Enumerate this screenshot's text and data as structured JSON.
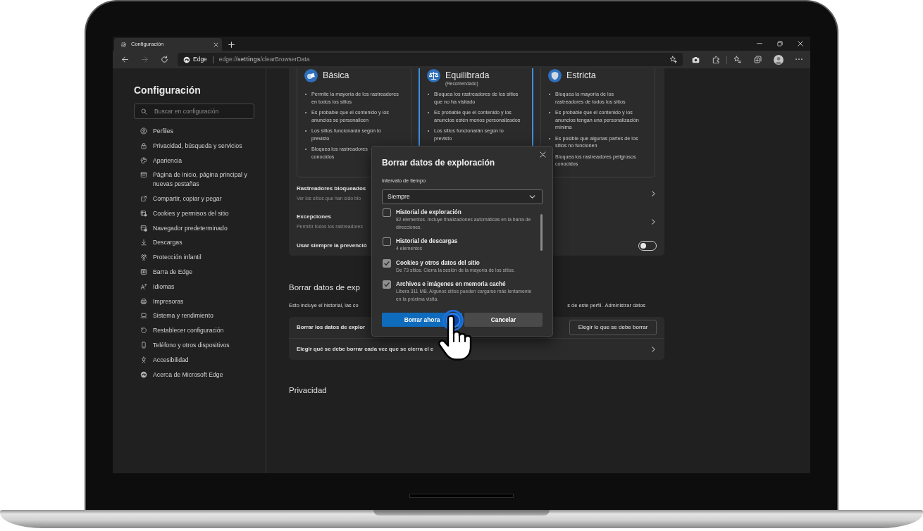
{
  "browser": {
    "tab": {
      "title": "Configuración"
    },
    "nav_buttons": [
      {
        "kind": "back",
        "disabled": false
      },
      {
        "kind": "forward",
        "disabled": true
      },
      {
        "kind": "refresh",
        "disabled": false
      }
    ],
    "address": {
      "label": "Edge",
      "url": "edge://**settings**/clearBrowserData"
    }
  },
  "sidebar": {
    "title": "Configuración",
    "search": {
      "placeholder": "Buscar en configuración"
    },
    "items": [
      {
        "label": "Perfiles",
        "selected": false
      },
      {
        "label": "Privacidad, búsqueda y servicios",
        "selected": false
      },
      {
        "label": "Apariencia",
        "selected": false
      },
      {
        "label": "Página de inicio, página principal y nuevas pestañas",
        "selected": false
      },
      {
        "label": "Compartir, copiar y pegar",
        "selected": false
      },
      {
        "label": "Cookies y permisos del sitio",
        "selected": false
      },
      {
        "label": "Navegador predeterminado",
        "selected": false
      },
      {
        "label": "Descargas",
        "selected": false
      },
      {
        "label": "Protección infantil",
        "selected": false
      },
      {
        "label": "Barra de Edge",
        "selected": false
      },
      {
        "label": "Idiomas",
        "selected": false
      },
      {
        "label": "Impresoras",
        "selected": false
      },
      {
        "label": "Sistema y rendimiento",
        "selected": false
      },
      {
        "label": "Restablecer configuración",
        "selected": false
      },
      {
        "label": "Teléfono y otros dispositivos",
        "selected": false
      },
      {
        "label": "Accesibilidad",
        "selected": false
      },
      {
        "label": "Acerca de Microsoft Edge",
        "selected": false
      }
    ]
  },
  "tracking_prevention": {
    "options": [
      {
        "title": "Básica",
        "selected": false,
        "bullets": [
          [
            "Permite la mayoría de los rastreadores",
            "en todos los sitios"
          ],
          [
            "Es probable que el contenido y los",
            "anuncios se personalicen"
          ],
          [
            "Los sitios funcionarán según lo",
            "previsto"
          ],
          [
            "Bloquea los rastreadores",
            "conocidos"
          ]
        ]
      },
      {
        "title": "Equilibrada",
        "subtitle": "(Recomendado)",
        "selected": true,
        "bullets": [
          [
            "Bloquea los rastreadores de los sitios",
            "que no ha visitado"
          ],
          [
            "Es probable que el contenido y los",
            "anuncios estén menos personalizados"
          ],
          [
            "Los sitios funcionarán según lo",
            "previsto"
          ]
        ]
      },
      {
        "title": "Estricta",
        "selected": false,
        "bullets": [
          [
            "Bloquea la mayoría de los",
            "rastreadores de todos los sitios"
          ],
          [
            "Es probable que el contenido y los",
            "anuncios tengan una personalización",
            "mínima"
          ],
          [
            "Es posible que algunas partes de los",
            "sitios no funcionen"
          ],
          [
            "Bloquea los rastreadores peligrosos",
            "conocidos"
          ]
        ]
      }
    ],
    "rows": [
      {
        "kind": "link",
        "title": "Rastreadores bloqueados",
        "description": "Ver los sitios que han sido blo"
      },
      {
        "kind": "link",
        "title": "Excepciones",
        "description": "Permitir todos los rastreadores"
      },
      {
        "kind": "toggle",
        "title": "Usar siempre la prevenció",
        "on": false
      }
    ]
  },
  "clear_data": {
    "heading": "Borrar datos de exp",
    "description_start": "Esto incluye el historial, las co",
    "description_end": "s de este perfil.",
    "link": "Administrar datos",
    "rows": [
      {
        "kind": "button",
        "title": "Borrar los datos de explor",
        "button": "Elegir lo que se debe borrar"
      },
      {
        "kind": "link",
        "title": "Elegir qué se debe borrar cada vez que se cierra el e"
      }
    ]
  },
  "privacy": {
    "heading": "Privacidad"
  },
  "dialog": {
    "title": "Borrar datos de exploración",
    "range_label": "Intervalo de tiempo",
    "range_value": "Siempre",
    "items": [
      {
        "title": "Historial de exploración",
        "detail": "82 elementos. Incluye finalizaciones automáticas en la barra de direcciones.",
        "checked": false
      },
      {
        "title": "Historial de descargas",
        "detail": "4 elementos",
        "checked": false
      },
      {
        "title": "Cookies y otros datos del sitio",
        "detail": "De 73 sitios. Cierra la sesión de la mayoría de los sitios.",
        "checked": true
      },
      {
        "title": "Archivos e imágenes en memoria caché",
        "detail": "Libera 311 MB. Algunos sitios pueden cargarse más lentamente en la próxima visita.",
        "checked": true
      }
    ],
    "buttons": [
      {
        "label": "Borrar ahora",
        "kind": "primary"
      },
      {
        "label": "Cancelar",
        "kind": "secondary"
      }
    ]
  }
}
